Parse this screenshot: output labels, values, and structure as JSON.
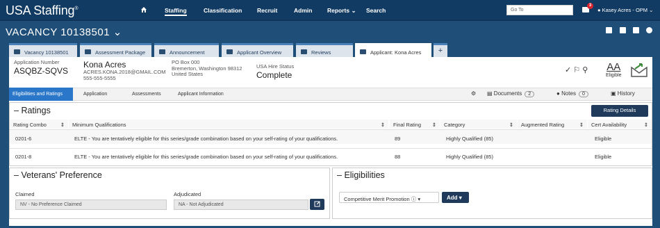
{
  "nav": {
    "logo": "USA Staffing",
    "items": [
      "Staffing",
      "Classification",
      "Recruit",
      "Admin",
      "Reports",
      "Search"
    ],
    "goto_placeholder": "Go To",
    "mail_count": "3",
    "user": "Kasey Acres - OPM"
  },
  "vacancy": {
    "title": "VACANCY 10138501"
  },
  "tabs": [
    "Vacancy 10138501",
    "Assessment Package",
    "Announcement",
    "Applicant Overview",
    "Reviews",
    "Applicant: Kona Acres"
  ],
  "applicant": {
    "app_number_label": "Application Number",
    "app_number": "ASQBZ-SQVS",
    "name": "Kona Acres",
    "email": "ACRES.KONA.2018@GMAIL.COM",
    "phone": "555-555-5555",
    "address1": "PO Box 000",
    "address2": "Bremerton, Washington 98312",
    "address3": "United States",
    "status_label": "USA Hire Status",
    "status": "Complete",
    "eligible_label": "Eligible",
    "aa": "AA"
  },
  "steps": [
    "Eligibilities and Ratings",
    "Application",
    "Assessments",
    "Applicant Information"
  ],
  "tools": {
    "documents": "Documents",
    "documents_count": "2",
    "notes": "Notes",
    "notes_count": "0",
    "history": "History"
  },
  "ratings": {
    "title": "Ratings",
    "button": "Rating Details",
    "columns": [
      "Rating Combo",
      "Minimum Qualifications",
      "Final Rating",
      "Category",
      "Augmented Rating",
      "Cert Availability"
    ],
    "rows": [
      [
        "0201-6",
        "ELTE - You are tentatively eligible for this series/grade combination based on your self-rating of your qualifications.",
        "89",
        "Highly Qualified (85)",
        "",
        "Eligible"
      ],
      [
        "0201-8",
        "ELTE - You are tentatively eligible for this series/grade combination based on your self-rating of your qualifications.",
        "88",
        "Highly Qualified (85)",
        "",
        "Eligible"
      ]
    ]
  },
  "veterans": {
    "title": "Veterans' Preference",
    "claimed_label": "Claimed",
    "claimed": "NV - No Preference Claimed",
    "adjudicated_label": "Adjudicated",
    "adjudicated": "NA - Not Adjudicated"
  },
  "eligibilities": {
    "title": "Eligibilities",
    "select": "Competitive Merit Promotion",
    "add": "Add"
  }
}
